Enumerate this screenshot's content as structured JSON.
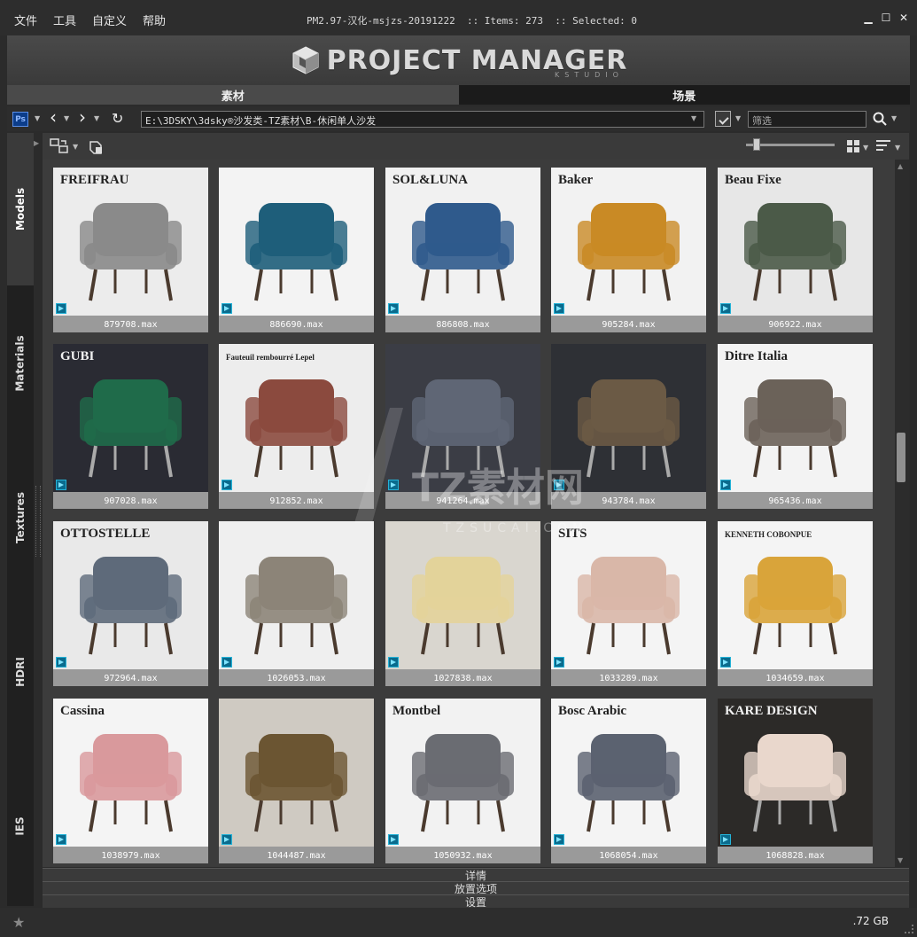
{
  "menu": [
    "文件",
    "工具",
    "自定义",
    "帮助"
  ],
  "window_title": "PM2.97-汉化-msjzs-20191222  :: Items: 273  :: Selected: 0",
  "logo": {
    "text": "PROJECT MANAGER",
    "sub": "KSTUDIO"
  },
  "tabs": [
    {
      "label": "素材",
      "active": true
    },
    {
      "label": "场景",
      "active": false
    }
  ],
  "toolbar": {
    "ps_label": "Ps",
    "back_glyph": "‹",
    "forward_glyph": "›",
    "refresh_glyph": "↻",
    "path": "E:\\3DSKY\\3dsky®沙发类-TZ素材\\B-休闲单人沙发",
    "search_placeholder": "筛选"
  },
  "sidebar_tabs": [
    {
      "label": "Models",
      "active": true
    },
    {
      "label": "Materials",
      "active": false
    },
    {
      "label": "Textures",
      "active": false
    },
    {
      "label": "HDRI",
      "active": false
    },
    {
      "label": "IES",
      "active": false
    }
  ],
  "items": [
    {
      "name": "879708.max",
      "bg": "#ececec",
      "accent": "#8a8a8a",
      "brand": "FREIFRAU"
    },
    {
      "name": "886690.max",
      "bg": "#f3f3f3",
      "accent": "#1e5e7a",
      "brand": ""
    },
    {
      "name": "886808.max",
      "bg": "#f1f1f1",
      "accent": "#2f5a8c",
      "brand": "SOL&LUNA"
    },
    {
      "name": "905284.max",
      "bg": "#f2f2f2",
      "accent": "#c98a25",
      "brand": "Baker"
    },
    {
      "name": "906922.max",
      "bg": "#e7e7e7",
      "accent": "#4b5a48",
      "brand": "Beau Fixe"
    },
    {
      "name": "907028.max",
      "bg": "#2a2b33",
      "accent": "#1f6b4a",
      "brand": "GUBI"
    },
    {
      "name": "912852.max",
      "bg": "#ededed",
      "accent": "#8b4a3e",
      "brand": "Fauteuil rembourré Lepel"
    },
    {
      "name": "941264.max",
      "bg": "#3b3d45",
      "accent": "#5f6675",
      "brand": ""
    },
    {
      "name": "943784.max",
      "bg": "#2e3035",
      "accent": "#6b5a45",
      "brand": ""
    },
    {
      "name": "965436.max",
      "bg": "#f3f3f3",
      "accent": "#6b6259",
      "brand": "Ditre Italia"
    },
    {
      "name": "972964.max",
      "bg": "#e9e9e9",
      "accent": "#5e6a7a",
      "brand": "OTTOSTELLE"
    },
    {
      "name": "1026053.max",
      "bg": "#efefef",
      "accent": "#8c8478",
      "brand": ""
    },
    {
      "name": "1027838.max",
      "bg": "#d9d6cf",
      "accent": "#e3d39a",
      "brand": ""
    },
    {
      "name": "1033289.max",
      "bg": "#f4f4f4",
      "accent": "#d9b7a8",
      "brand": "SITS"
    },
    {
      "name": "1034659.max",
      "bg": "#f4f4f4",
      "accent": "#d9a43a",
      "brand": "KENNETH COBONPUE"
    },
    {
      "name": "1038979.max",
      "bg": "#f4f4f4",
      "accent": "#d9999c",
      "brand": "Cassina"
    },
    {
      "name": "1044487.max",
      "bg": "#cfcac2",
      "accent": "#6b5532",
      "brand": ""
    },
    {
      "name": "1050932.max",
      "bg": "#f2f2f2",
      "accent": "#6a6c72",
      "brand": "Montbel"
    },
    {
      "name": "1068054.max",
      "bg": "#f4f4f4",
      "accent": "#5b6270",
      "brand": "Bosc Arabic"
    },
    {
      "name": "1068828.max",
      "bg": "#2c2a28",
      "accent": "#e9d7cc",
      "brand": "KARE DESIGN"
    }
  ],
  "panels": [
    "详情",
    "放置选项",
    "设置"
  ],
  "status": {
    "size": ".72 GB"
  }
}
